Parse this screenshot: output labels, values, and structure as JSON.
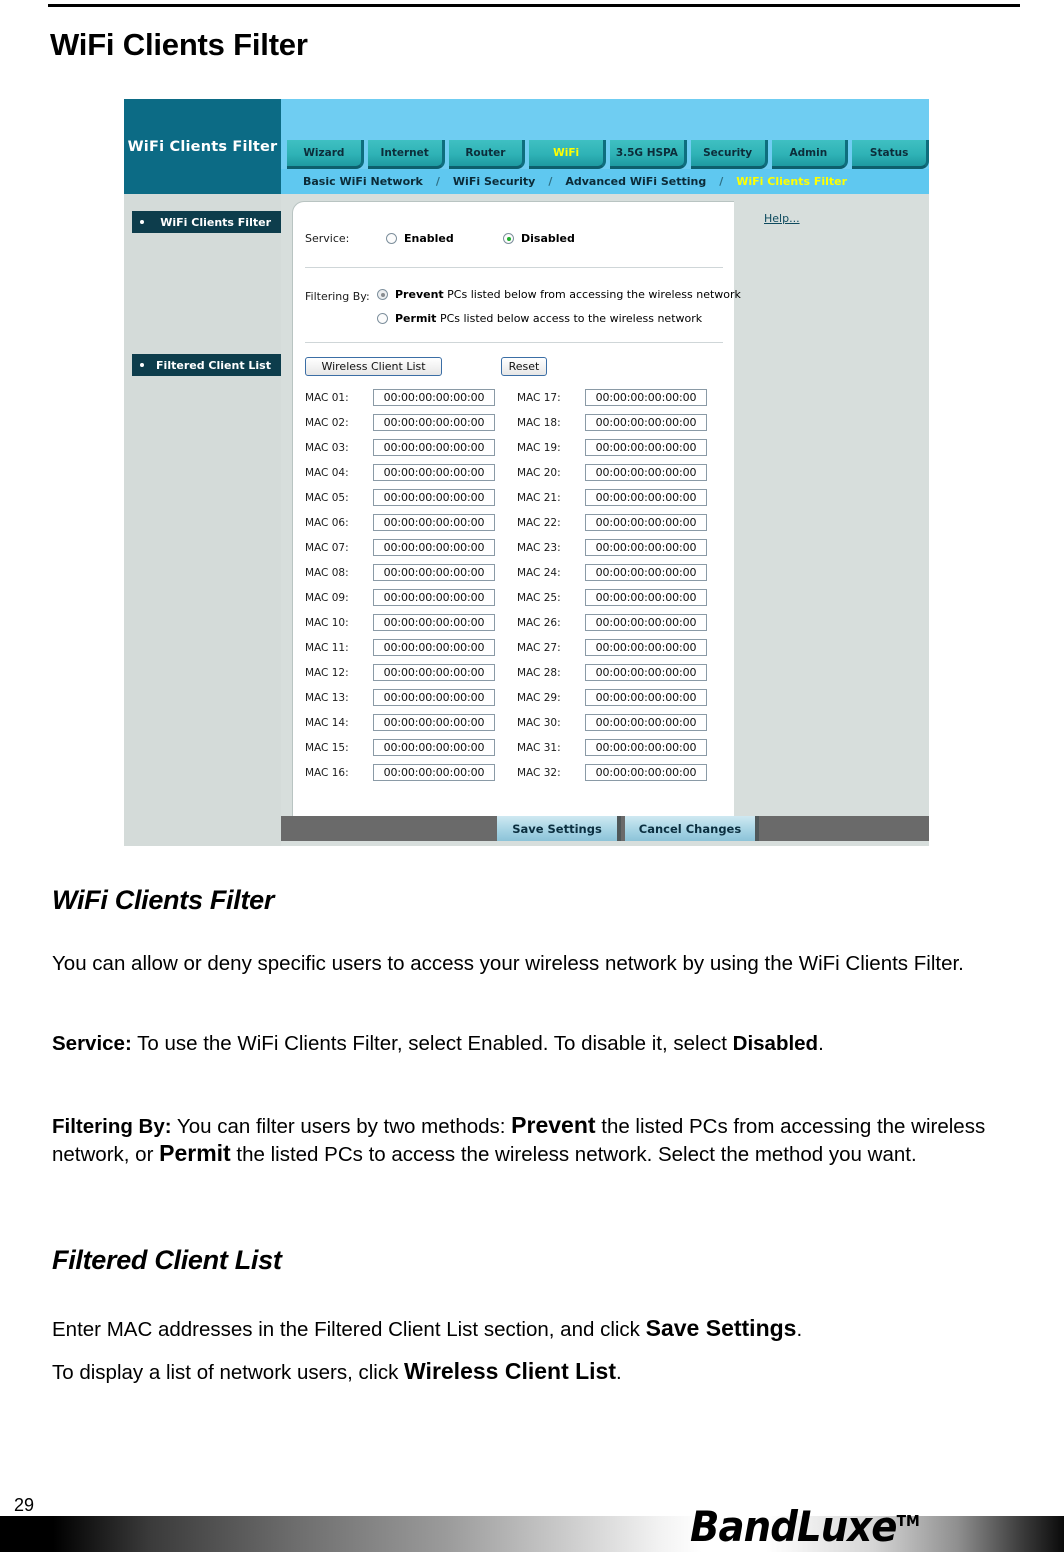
{
  "document": {
    "page_title": "WiFi Clients Filter",
    "page_number": "29",
    "brand": "BandLuxe",
    "brand_tm": "TM"
  },
  "router_ui": {
    "brand_box_label": "WiFi Clients Filter",
    "nav_tabs": [
      {
        "label": "Wizard",
        "active": false
      },
      {
        "label": "Internet",
        "active": false
      },
      {
        "label": "Router",
        "active": false
      },
      {
        "label": "WiFi",
        "active": true
      },
      {
        "label": "3.5G HSPA",
        "active": false
      },
      {
        "label": "Security",
        "active": false
      },
      {
        "label": "Admin",
        "active": false
      },
      {
        "label": "Status",
        "active": false
      }
    ],
    "breadcrumb": [
      {
        "label": "Basic WiFi Network",
        "active": false
      },
      {
        "label": "WiFi Security",
        "active": false
      },
      {
        "label": "Advanced WiFi Setting",
        "active": false
      },
      {
        "label": "WiFi Clients Filter",
        "active": true
      }
    ],
    "breadcrumb_separator": "/",
    "sidebar": {
      "section_1": "WiFi Clients Filter",
      "section_2": "Filtered Client List"
    },
    "form": {
      "service_label": "Service:",
      "service_options": [
        {
          "label": "Enabled",
          "selected": false
        },
        {
          "label": "Disabled",
          "selected": true
        }
      ],
      "filtering_label": "Filtering By:",
      "filtering_options": [
        {
          "strong": "Prevent",
          "rest": " PCs listed below from accessing the wireless network",
          "selected": true
        },
        {
          "strong": "Permit",
          "rest": " PCs listed below access to the wireless network",
          "selected": false
        }
      ],
      "wireless_client_list_button": "Wireless Client List",
      "reset_button": "Reset"
    },
    "mac_list": {
      "default_value": "00:00:00:00:00:00",
      "left_column": [
        {
          "label": "MAC 01:",
          "value": "00:00:00:00:00:00"
        },
        {
          "label": "MAC 02:",
          "value": "00:00:00:00:00:00"
        },
        {
          "label": "MAC 03:",
          "value": "00:00:00:00:00:00"
        },
        {
          "label": "MAC 04:",
          "value": "00:00:00:00:00:00"
        },
        {
          "label": "MAC 05:",
          "value": "00:00:00:00:00:00"
        },
        {
          "label": "MAC 06:",
          "value": "00:00:00:00:00:00"
        },
        {
          "label": "MAC 07:",
          "value": "00:00:00:00:00:00"
        },
        {
          "label": "MAC 08:",
          "value": "00:00:00:00:00:00"
        },
        {
          "label": "MAC 09:",
          "value": "00:00:00:00:00:00"
        },
        {
          "label": "MAC 10:",
          "value": "00:00:00:00:00:00"
        },
        {
          "label": "MAC 11:",
          "value": "00:00:00:00:00:00"
        },
        {
          "label": "MAC 12:",
          "value": "00:00:00:00:00:00"
        },
        {
          "label": "MAC 13:",
          "value": "00:00:00:00:00:00"
        },
        {
          "label": "MAC 14:",
          "value": "00:00:00:00:00:00"
        },
        {
          "label": "MAC 15:",
          "value": "00:00:00:00:00:00"
        },
        {
          "label": "MAC 16:",
          "value": "00:00:00:00:00:00"
        }
      ],
      "right_column": [
        {
          "label": "MAC 17:",
          "value": "00:00:00:00:00:00"
        },
        {
          "label": "MAC 18:",
          "value": "00:00:00:00:00:00"
        },
        {
          "label": "MAC 19:",
          "value": "00:00:00:00:00:00"
        },
        {
          "label": "MAC 20:",
          "value": "00:00:00:00:00:00"
        },
        {
          "label": "MAC 21:",
          "value": "00:00:00:00:00:00"
        },
        {
          "label": "MAC 22:",
          "value": "00:00:00:00:00:00"
        },
        {
          "label": "MAC 23:",
          "value": "00:00:00:00:00:00"
        },
        {
          "label": "MAC 24:",
          "value": "00:00:00:00:00:00"
        },
        {
          "label": "MAC 25:",
          "value": "00:00:00:00:00:00"
        },
        {
          "label": "MAC 26:",
          "value": "00:00:00:00:00:00"
        },
        {
          "label": "MAC 27:",
          "value": "00:00:00:00:00:00"
        },
        {
          "label": "MAC 28:",
          "value": "00:00:00:00:00:00"
        },
        {
          "label": "MAC 29:",
          "value": "00:00:00:00:00:00"
        },
        {
          "label": "MAC 30:",
          "value": "00:00:00:00:00:00"
        },
        {
          "label": "MAC 31:",
          "value": "00:00:00:00:00:00"
        },
        {
          "label": "MAC 32:",
          "value": "00:00:00:00:00:00"
        }
      ]
    },
    "help_link": "Help...",
    "footer_buttons": {
      "save": "Save Settings",
      "cancel": "Cancel Changes"
    },
    "colors": {
      "banner_blue": "#6fcdf2",
      "brand_teal": "#0c6b85",
      "tab_teal": "#2fb2b6",
      "active_yellow": "#ffff00",
      "sidebar_gray": "#d4dbd9",
      "footer_gray": "#6a6a6a",
      "button_blue": "#a7d4e4",
      "radio_green": "#1fae2e"
    }
  },
  "article": {
    "section_1_title": "WiFi Clients Filter",
    "intro": "You can allow or deny specific users to access your wireless network by using the WiFi Clients Filter.",
    "service_term": "Service:",
    "service_text_1": " To use the WiFi Clients Filter, select Enabled. To disable it, select ",
    "service_term_2": "Disabled",
    "service_text_2": ".",
    "filtering_term": "Filtering By:",
    "filtering_text_1": " You can filter users by two methods: ",
    "filtering_term_2": "Prevent",
    "filtering_text_2": " the listed PCs from accessing the wireless network, or ",
    "filtering_term_3": "Permit",
    "filtering_text_3": " the listed PCs to access the wireless network. Select the method you want.",
    "section_2_title": "Filtered Client List",
    "enter_text_1": "Enter MAC addresses in the Filtered Client List section, and click ",
    "enter_term": "Save Settings",
    "enter_text_2": ".",
    "display_text_1": "To display a list of network users, click ",
    "display_term": "Wireless Client List",
    "display_text_2": "."
  }
}
